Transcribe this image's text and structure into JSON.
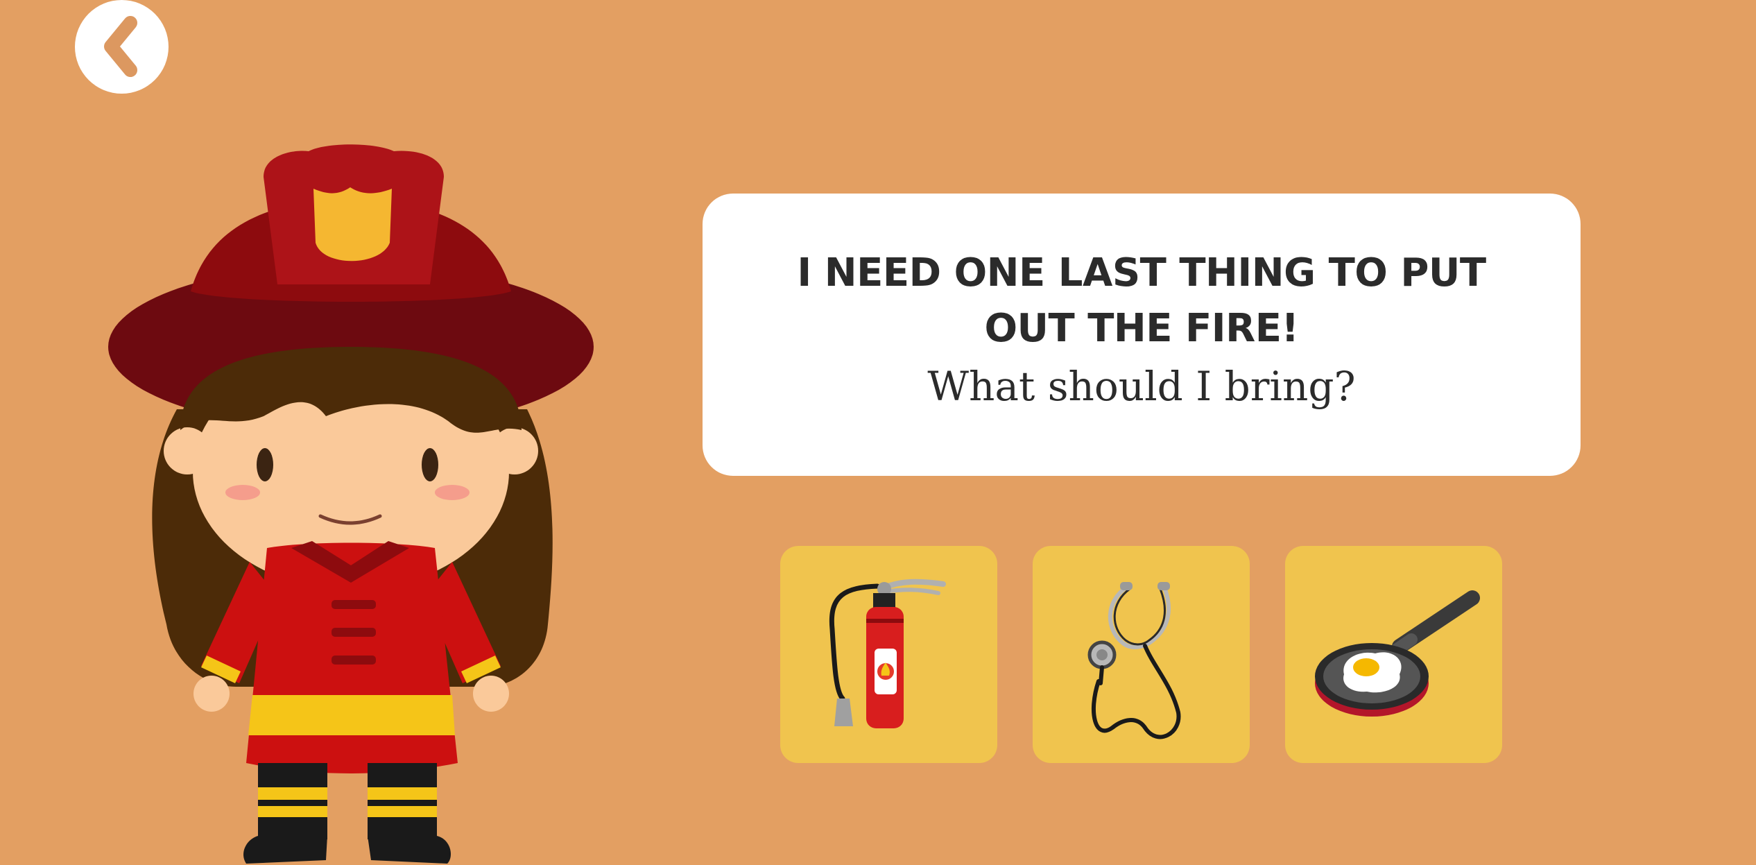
{
  "colors": {
    "background": "#e39f62",
    "panel": "#ffffff",
    "tile": "#f0c44e",
    "text": "#2b2b2b"
  },
  "header": {
    "back_icon": "chevron-left-icon"
  },
  "character": {
    "icon": "firefighter-girl-illustration"
  },
  "prompt": {
    "heading": "I NEED ONE LAST THING TO PUT OUT THE FIRE!",
    "question": "What should I bring?"
  },
  "choices": [
    {
      "icon": "fire-extinguisher-icon"
    },
    {
      "icon": "stethoscope-icon"
    },
    {
      "icon": "frying-pan-icon"
    }
  ]
}
